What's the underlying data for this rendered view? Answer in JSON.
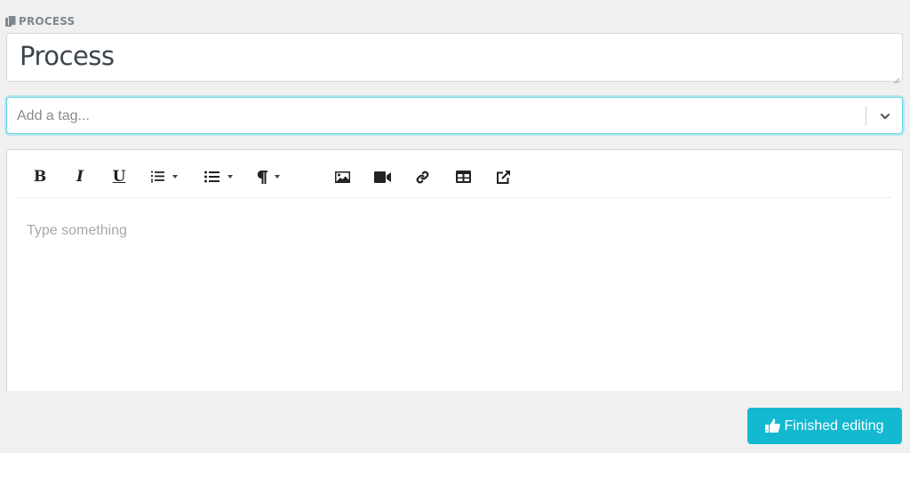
{
  "section": {
    "label": "PROCESS",
    "icon": "copy-icon"
  },
  "title_field": {
    "value": "Process"
  },
  "tag_field": {
    "placeholder": "Add a tag...",
    "value": "",
    "dropdown_icon": "chevron-down-icon"
  },
  "editor": {
    "toolbar": [
      {
        "name": "bold",
        "label": "B",
        "icon": "bold-icon"
      },
      {
        "name": "italic",
        "label": "I",
        "icon": "italic-icon"
      },
      {
        "name": "underline",
        "label": "U",
        "icon": "underline-icon"
      },
      {
        "name": "ordered-list",
        "icon": "ordered-list-icon",
        "has_dropdown": true
      },
      {
        "name": "unordered-list",
        "icon": "unordered-list-icon",
        "has_dropdown": true
      },
      {
        "name": "paragraph",
        "icon": "paragraph-icon",
        "has_dropdown": true
      },
      {
        "name": "image",
        "icon": "image-icon"
      },
      {
        "name": "video",
        "icon": "video-icon"
      },
      {
        "name": "link",
        "icon": "link-icon"
      },
      {
        "name": "table",
        "icon": "table-icon"
      },
      {
        "name": "external-link",
        "icon": "external-link-icon"
      }
    ],
    "placeholder": "Type something"
  },
  "finish_button": {
    "label": "Finished editing",
    "icon": "thumbs-up-icon",
    "color": "#13b8d1"
  },
  "colors": {
    "background": "#f0f0f0",
    "focus_ring": "#5fd3e6",
    "label_text": "#7d8790"
  }
}
